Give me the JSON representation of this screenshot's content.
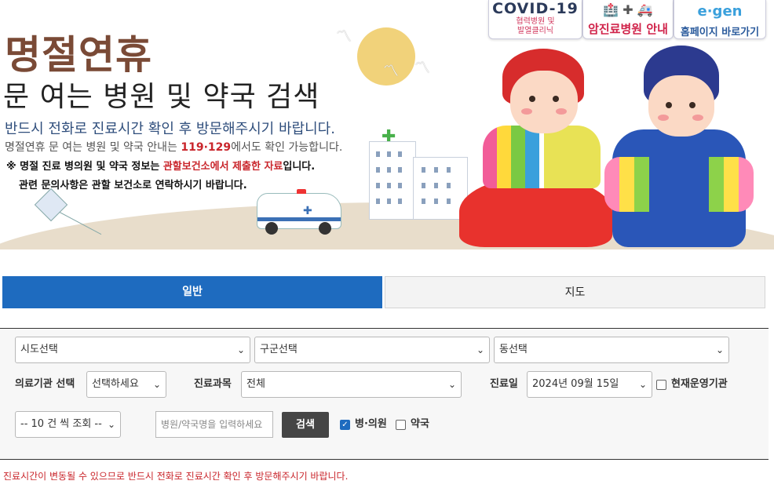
{
  "banner": {
    "title": "명절연휴",
    "subtitle": "문 여는 병원 및 약국 검색",
    "line1": "반드시 전화로 진료시간 확인 후 방문해주시기 바랍니다.",
    "line2_prefix": "명절연휴 문 여는 병원 및 약국 안내는 ",
    "line2_numbers": "119·129",
    "line2_suffix": "에서도 확인 가능합니다.",
    "notice_prefix": "※ 명절 진료 병의원 및 약국 정보는 ",
    "notice_highlight": "관할보건소에서 제출한 자료",
    "notice_suffix": "입니다.",
    "notice_line2": "관련 문의사항은 관할 보건소로 연락하시기 바랍니다."
  },
  "badges": {
    "covid_title": "COVID-19",
    "covid_line1": "협력병원 및",
    "covid_line2": "발열클리닉",
    "cancer_label": "암진료병원 안내",
    "home_logo": "e·gen",
    "home_label": "홈페이지 바로가기"
  },
  "tabs": {
    "general": "일반",
    "map": "지도"
  },
  "form": {
    "sido": "시도선택",
    "gugun": "구군선택",
    "dong": "동선택",
    "institution_label": "의료기관 선택",
    "institution_value": "선택하세요",
    "department_label": "진료과목",
    "department_value": "전체",
    "date_label": "진료일",
    "date_value": "2024년 09월 15일",
    "operating_label": "현재운영기관",
    "page_size": "-- 10 건 씩 조회 --",
    "name_placeholder": "병원/약국명을 입력하세요",
    "search_button": "검색",
    "hospital_label": "병·의원",
    "pharmacy_label": "약국",
    "hospital_checked": true,
    "pharmacy_checked": false,
    "operating_checked": false
  },
  "footer_notice": "진료시간이 변동될 수 있으므로 반드시 전화로 진료시간 확인 후 방문해주시기 바랍니다.",
  "colors": {
    "accent": "#1e6bbf",
    "title_brown": "#7a4a36",
    "alert_red": "#c9252b"
  }
}
